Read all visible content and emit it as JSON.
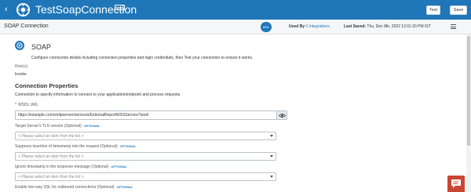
{
  "header": {
    "back_icon": "chevron-left-icon",
    "logo_icon": "integration-logo-icon",
    "title": "TestSoapConnection",
    "badge": "Draft",
    "test_label": "Test",
    "save_label": "Save",
    "background_color": "#1f76b8"
  },
  "subheader": {
    "title": "SOAP Connection",
    "progress": "85%",
    "used_by_label": "Used By",
    "used_by_value": "0 Integrations",
    "last_saved_label": "Last Saved:",
    "last_saved_value": "Thu, Dec 8th, 2022 12:01:20 PM IST",
    "menu_icon": "hamburger-menu-icon"
  },
  "adapter": {
    "icon": "soap-adapter-icon",
    "name": "SOAP",
    "description": "Configure connection details including connection properties and login credentials, then Test your connection to ensure it works.",
    "role_label": "Role(s)",
    "role_value": "Invoke"
  },
  "connection_properties": {
    "title": "Connection Properties",
    "description": "Connection to specify information to connect to your application/endpoint and process requests.",
    "wsdl": {
      "required_marker": "*",
      "label": "WSDL URL",
      "value": "https://example.com/xmlpserver/services/ExternalReportWSSService?wsdl",
      "eye_icon": "eye-icon"
    },
    "fields": [
      {
        "label": "Target Server's TLS version (Optional)",
        "optional": "OPTIONAL",
        "placeholder": "< Please select an item from the list >"
      },
      {
        "label": "Suppress insertion of timestamp into the request (Optional)",
        "optional": "OPTIONAL",
        "placeholder": "< Please select an item from the list >"
      },
      {
        "label": "Ignore timestamp in the response message (Optional)",
        "optional": "OPTIONAL",
        "placeholder": "< Please select an item from the list >"
      },
      {
        "label": "Enable two way SSL for outbound connections (Optional)",
        "optional": "OPTIONAL"
      }
    ]
  },
  "chat": {
    "icon": "chat-bubble-icon",
    "color": "#c74634"
  }
}
